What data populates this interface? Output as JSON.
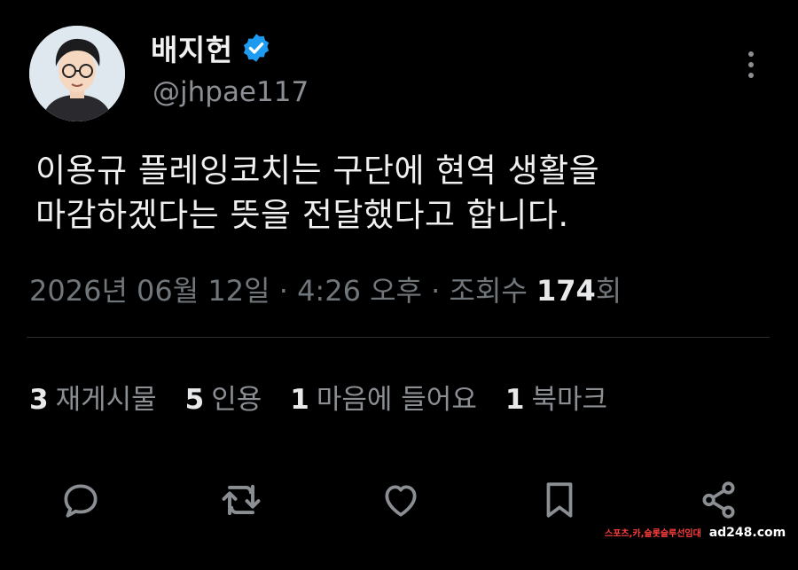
{
  "author": {
    "name": "배지헌",
    "handle": "@jhpae117",
    "verified_color": "#1d9bf0"
  },
  "tweet": {
    "lines": [
      "이용규 플레잉코치는 구단에 현역 생활을",
      "마감하겠다는 뜻을 전달했다고 합니다."
    ]
  },
  "meta": {
    "date": "2026년 06월 12일",
    "time": "4:26 오후",
    "views_label": "조회수",
    "views_count": "174",
    "views_suffix": "회"
  },
  "stats": [
    {
      "count": "3",
      "label": "재게시물"
    },
    {
      "count": "5",
      "label": "인용"
    },
    {
      "count": "1",
      "label": "마음에 들어요"
    },
    {
      "count": "1",
      "label": "북마크"
    }
  ],
  "actions": [
    "reply-icon",
    "retweet-icon",
    "like-icon",
    "bookmark-icon",
    "share-icon"
  ],
  "watermark": {
    "text": "스포츠,카,슬롯슬루선임대",
    "url": "ad248.com"
  }
}
